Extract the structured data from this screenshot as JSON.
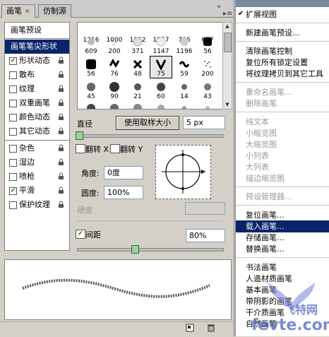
{
  "tabs": {
    "brush": "画笔",
    "clone_source": "仿制源"
  },
  "left_list": {
    "header": "画笔预设",
    "selected": "画笔笔尖形状",
    "items": [
      {
        "label": "形状动态",
        "checked": true
      },
      {
        "label": "散布",
        "checked": false
      },
      {
        "label": "纹理",
        "checked": false
      },
      {
        "label": "双重画笔",
        "checked": false
      },
      {
        "label": "颜色动态",
        "checked": false
      },
      {
        "label": "其它动态",
        "checked": false
      },
      {
        "label": "杂色",
        "checked": false
      },
      {
        "label": "湿边",
        "checked": false
      },
      {
        "label": "喷枪",
        "checked": false
      },
      {
        "label": "平滑",
        "checked": true
      },
      {
        "label": "保护纹理",
        "checked": false
      }
    ]
  },
  "brush_sizes": {
    "row1": [
      "1216",
      "1000",
      "1162",
      "1057",
      "786",
      "677"
    ],
    "row2": [
      "609",
      "200",
      "371",
      "1147",
      "1196",
      "56"
    ],
    "row3": [
      "56",
      "76",
      "48",
      "75",
      "59",
      "200"
    ],
    "row4": [
      "45",
      "90",
      "21",
      "60",
      "14",
      "43"
    ]
  },
  "controls": {
    "diameter_label": "直径",
    "use_sample_size": "使用取样大小",
    "diameter_value": "5 px",
    "flip_x": "翻转 X",
    "flip_y": "翻转 Y",
    "angle_label": "角度:",
    "angle_value": "0度",
    "roundness_label": "圆度:",
    "roundness_value": "100%",
    "hardness_label": "硬度",
    "spacing_label": "间距",
    "spacing_value": "80%"
  },
  "menu": {
    "expanded_view": "扩展视图",
    "new_preset": "新建画笔预设...",
    "clear_controls": "清除画笔控制",
    "reset_locked": "复位所有锁定设置",
    "copy_texture": "将纹理拷贝到其它工具",
    "rename": "重命名画笔...",
    "delete": "删除画笔",
    "text_only": "纯文本",
    "small_thumb": "小缩览图",
    "large_thumb": "大缩览图",
    "small_list": "小列表",
    "large_list": "大列表",
    "stroke_thumb": "描边缩览图",
    "preset_manager": "预设管理器...",
    "reset_brushes": "复位画笔...",
    "load_brushes": "载入画笔...",
    "save_brushes": "存储画笔...",
    "replace_brushes": "替换画笔...",
    "calligraphic": "书法画笔",
    "artist_brushes": "人造材质画笔",
    "basic": "基本画笔",
    "shadow": "带阴影的画笔",
    "dry_media": "干介质画笔",
    "natural": "自然画笔"
  },
  "watermark": {
    "site": "fevte.com",
    "brand": "飞特网"
  },
  "colors": {
    "selection": "#0a246a",
    "panel": "#d4d0c8",
    "check": "#2a7a2a"
  }
}
